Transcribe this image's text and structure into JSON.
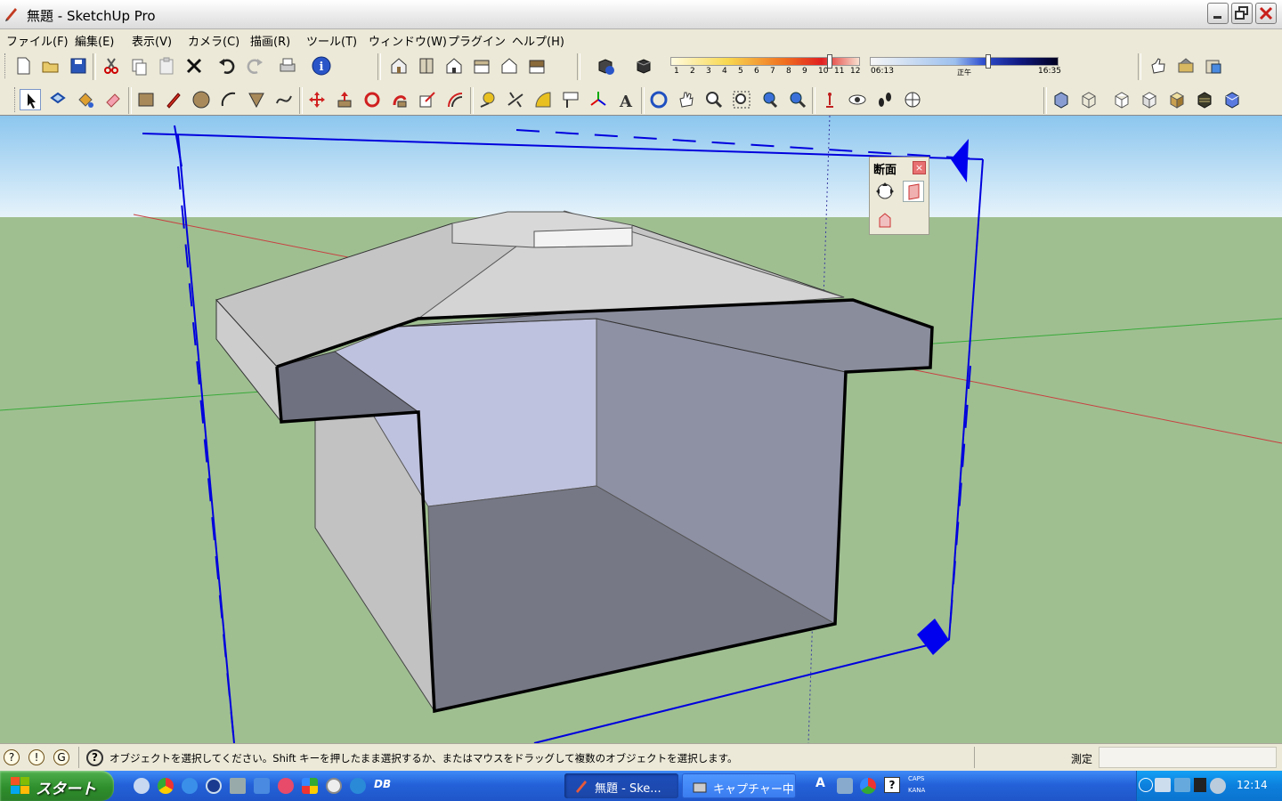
{
  "window": {
    "title": "無題 - SketchUp Pro"
  },
  "menubar": {
    "items": [
      "ファイル(F)",
      "編集(E)",
      "表示(V)",
      "カメラ(C)",
      "描画(R)",
      "ツール(T)",
      "ウィンドウ(W)",
      "プラグイン",
      "ヘルプ(H)"
    ]
  },
  "shadow_settings": {
    "months": [
      "1",
      "2",
      "3",
      "4",
      "5",
      "6",
      "7",
      "8",
      "9",
      "10",
      "11",
      "12"
    ],
    "time_start": "06:13",
    "time_noon": "正午",
    "time_end": "16:35"
  },
  "section_panel": {
    "title": "断面",
    "close_glyph": "×"
  },
  "statusbar": {
    "help_glyph": "?",
    "message": "オブジェクトを選択してください。Shift キーを押したまま選択するか、またはマウスをドラッグして複数のオブジェクトを選択します。",
    "measure_label": "測定",
    "measure_value": ""
  },
  "taskbar": {
    "start_label": "スタート",
    "tasks": [
      "無題 - Ske...",
      "キャプチャー中"
    ],
    "tray_caps": "CAPS",
    "tray_kana": "KANA",
    "clock": "12:14"
  },
  "colors": {
    "sky": "#a9d4ef",
    "ground": "#9fbf91",
    "section_plane": "#0000dd",
    "taskbar": "#245edb",
    "start_green": "#3a9b36"
  }
}
